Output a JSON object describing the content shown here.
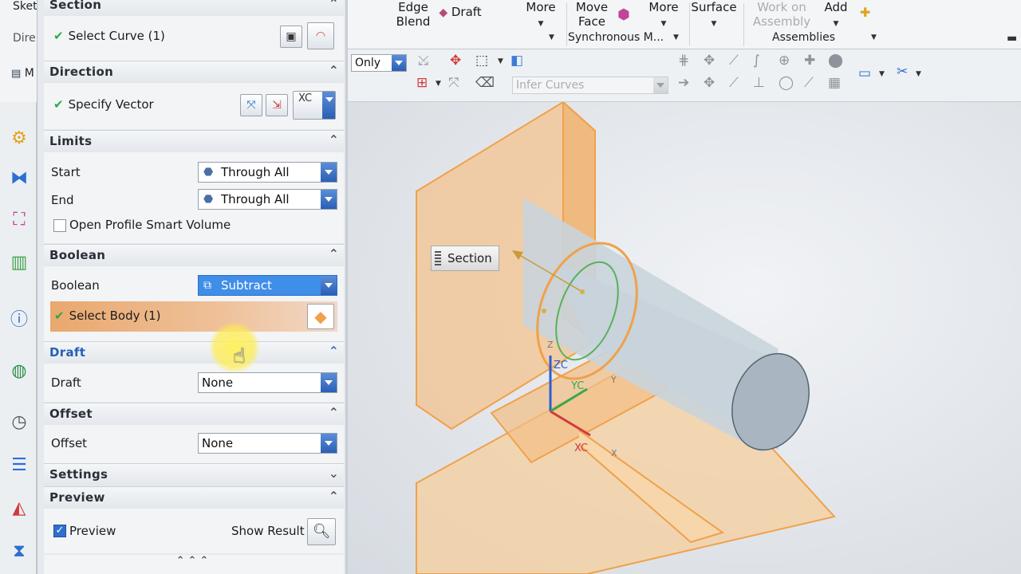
{
  "ribbon_left": {
    "top_text": "Sket",
    "dir_text": "Dire",
    "m_text": "M"
  },
  "ribbon": {
    "buttons": {
      "edge_blend": "Edge\nBlend",
      "draft": "Draft",
      "more1": "More",
      "move_face": "Move\nFace",
      "more2": "More",
      "surface": "Surface",
      "work_on_assembly": "Work on\nAssembly",
      "add": "Add"
    },
    "groups": {
      "synchronous": "Synchronous M...",
      "assemblies": "Assemblies"
    }
  },
  "toolbar": {
    "filter_value": "Only",
    "curve_rule": "Infer Curves"
  },
  "dialog": {
    "section": {
      "title": "Section",
      "select_curve": "Select Curve (1)"
    },
    "direction": {
      "title": "Direction",
      "specify_vector": "Specify Vector",
      "vector_label": "XC"
    },
    "limits": {
      "title": "Limits",
      "start_label": "Start",
      "start_value": "Through All",
      "end_label": "End",
      "end_value": "Through All",
      "open_profile": "Open Profile Smart Volume"
    },
    "boolean": {
      "title": "Boolean",
      "label": "Boolean",
      "value": "Subtract",
      "select_body": "Select Body (1)"
    },
    "draft": {
      "title": "Draft",
      "label": "Draft",
      "value": "None"
    },
    "offset": {
      "title": "Offset",
      "label": "Offset",
      "value": "None"
    },
    "settings": {
      "title": "Settings"
    },
    "preview": {
      "title": "Preview",
      "checkbox_label": "Preview",
      "show_result": "Show Result",
      "checked": true
    }
  },
  "viewport": {
    "tooltip": "Section",
    "axes": {
      "zc": "ZC",
      "yc": "YC",
      "xc": "XC",
      "z": "Z",
      "y": "Y",
      "x": "X"
    }
  },
  "colors": {
    "accent_blue": "#3f8ee8",
    "highlight_orange": "#e9a86e",
    "body_orange": "#f0a14a",
    "check_green": "#2ea84a"
  }
}
